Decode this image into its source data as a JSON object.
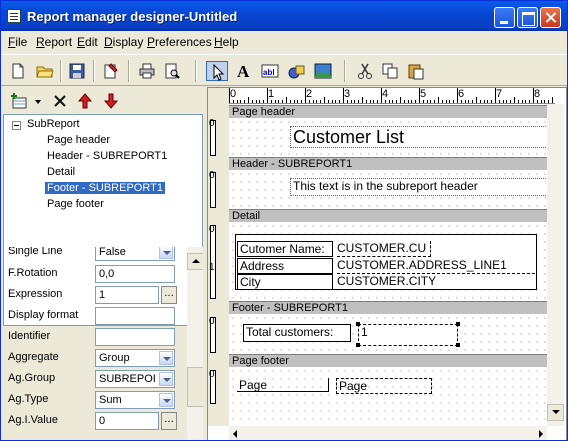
{
  "window": {
    "title": "Report manager designer-Untitled"
  },
  "menu": [
    {
      "u": "F",
      "rest": "ile"
    },
    {
      "u": "R",
      "rest": "eport"
    },
    {
      "u": "E",
      "rest": "dit"
    },
    {
      "u": "D",
      "rest": "isplay"
    },
    {
      "u": "P",
      "rest": "references"
    },
    {
      "u": "H",
      "rest": "elp"
    }
  ],
  "tree": {
    "root": "SubReport",
    "items": [
      "Page header",
      "Header - SUBREPORT1",
      "Detail",
      "Footer - SUBREPORT1",
      "Page footer"
    ],
    "selected": "Footer - SUBREPORT1"
  },
  "properties": {
    "partial_label": "Single Line",
    "partial_value": "False",
    "rows": [
      {
        "label": "F.Rotation",
        "value": "0,0"
      },
      {
        "label": "Expression",
        "value": "1"
      },
      {
        "label": "Display format",
        "value": ""
      },
      {
        "label": "Identifier",
        "value": ""
      },
      {
        "label": "Aggregate",
        "value": "Group"
      },
      {
        "label": "Ag.Group",
        "value": "SUBREPOI"
      },
      {
        "label": "Ag.Type",
        "value": "Sum"
      },
      {
        "label": "Ag.I.Value",
        "value": "0"
      }
    ]
  },
  "ruler": {
    "h": [
      "0",
      "1",
      "2",
      "3",
      "4",
      "5",
      "6",
      "7",
      "8"
    ]
  },
  "designer": {
    "page_header": {
      "bar": "Page header",
      "title": "Customer List"
    },
    "sub_header": {
      "bar": "Header - SUBREPORT1",
      "text": "This text is in the subreport header"
    },
    "detail": {
      "bar": "Detail",
      "labels": [
        "Cutomer Name:",
        "Address",
        "City"
      ],
      "fields": [
        "CUSTOMER.CU",
        "CUSTOMER.ADDRESS_LINE1",
        "CUSTOMER.CITY"
      ]
    },
    "sub_footer": {
      "bar": "Footer - SUBREPORT1",
      "label": "Total customers:",
      "field": "1"
    },
    "page_footer": {
      "bar": "Page footer",
      "label": "Page",
      "field": "Page"
    }
  },
  "colors": {
    "title_bar": "#0a5ae8",
    "selection": "#316ac5",
    "band_bar": "#c0c0c0"
  }
}
